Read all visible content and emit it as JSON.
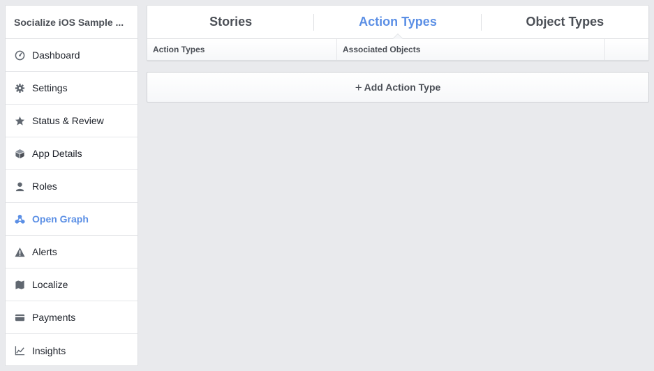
{
  "sidebar": {
    "app_title": "Socialize iOS Sample ...",
    "active_color": "#5b8fe5",
    "items": [
      {
        "label": "Dashboard",
        "icon": "dashboard-icon"
      },
      {
        "label": "Settings",
        "icon": "gear-icon"
      },
      {
        "label": "Status & Review",
        "icon": "star-icon"
      },
      {
        "label": "App Details",
        "icon": "cube-icon"
      },
      {
        "label": "Roles",
        "icon": "person-icon"
      },
      {
        "label": "Open Graph",
        "icon": "graph-icon",
        "active": true
      },
      {
        "label": "Alerts",
        "icon": "warning-icon"
      },
      {
        "label": "Localize",
        "icon": "flag-icon"
      },
      {
        "label": "Payments",
        "icon": "card-icon"
      },
      {
        "label": "Insights",
        "icon": "chart-icon"
      }
    ]
  },
  "tabs": [
    {
      "label": "Stories"
    },
    {
      "label": "Action Types",
      "active": true
    },
    {
      "label": "Object Types"
    }
  ],
  "table": {
    "columns": [
      "Action Types",
      "Associated Objects",
      ""
    ]
  },
  "add_button": {
    "plus": "+",
    "label": "Add Action Type"
  }
}
